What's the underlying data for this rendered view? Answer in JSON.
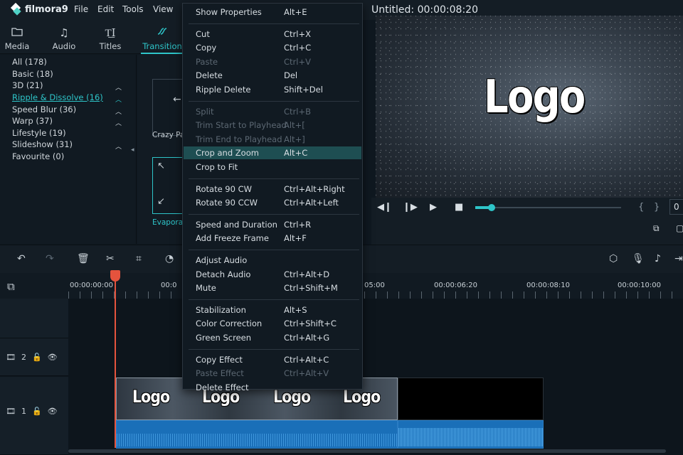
{
  "menubar": {
    "app_name": "filmora9",
    "items": [
      "File",
      "Edit",
      "Tools",
      "View"
    ],
    "project_title": "Untitled:",
    "project_time": "00:00:08:20"
  },
  "tabs": [
    {
      "label": "Media",
      "icon": "folder-icon"
    },
    {
      "label": "Audio",
      "icon": "music-icon"
    },
    {
      "label": "Titles",
      "icon": "titles-icon"
    },
    {
      "label": "Transition",
      "icon": "transition-icon",
      "active": true
    }
  ],
  "categories": [
    {
      "label": "All (178)"
    },
    {
      "label": "Basic (18)"
    },
    {
      "label": "3D (21)",
      "chevron": true
    },
    {
      "label": "Ripple & Dissolve (16)",
      "chevron": true,
      "selected": true
    },
    {
      "label": "Speed Blur (36)",
      "chevron": true
    },
    {
      "label": "Warp (37)",
      "chevron": true
    },
    {
      "label": "Lifestyle (19)"
    },
    {
      "label": "Slideshow (31)",
      "chevron": true
    },
    {
      "label": "Favourite (0)"
    }
  ],
  "thumbnails": [
    {
      "label": "Crazy Pa"
    },
    {
      "label": "Evapora",
      "selected": true
    }
  ],
  "preview": {
    "overlay_text": "Logo"
  },
  "player": {
    "progress": 0.1,
    "time_partial": "0"
  },
  "ruler": {
    "ticks": [
      "00:00:00:00",
      "00:0",
      "05:00",
      "00:00:06:20",
      "00:00:08:10",
      "00:00:10:00"
    ]
  },
  "tracks": [
    {
      "number": "2"
    },
    {
      "number": "1"
    }
  ],
  "clip": {
    "logo_text": "Logo"
  },
  "context_menu": {
    "items": [
      {
        "label": "Show Properties",
        "shortcut": "Alt+E"
      },
      {
        "sep": true
      },
      {
        "label": "Cut",
        "shortcut": "Ctrl+X"
      },
      {
        "label": "Copy",
        "shortcut": "Ctrl+C"
      },
      {
        "label": "Paste",
        "shortcut": "Ctrl+V",
        "disabled": true
      },
      {
        "label": "Delete",
        "shortcut": "Del"
      },
      {
        "label": "Ripple Delete",
        "shortcut": "Shift+Del"
      },
      {
        "sep": true
      },
      {
        "label": "Split",
        "shortcut": "Ctrl+B",
        "disabled": true
      },
      {
        "label": "Trim Start to Playhead",
        "shortcut": "Alt+[",
        "disabled": true
      },
      {
        "label": "Trim End to Playhead",
        "shortcut": "Alt+]",
        "disabled": true
      },
      {
        "label": "Crop and Zoom",
        "shortcut": "Alt+C",
        "highlighted": true
      },
      {
        "label": "Crop to Fit",
        "shortcut": ""
      },
      {
        "sep": true
      },
      {
        "label": "Rotate 90 CW",
        "shortcut": "Ctrl+Alt+Right"
      },
      {
        "label": "Rotate 90 CCW",
        "shortcut": "Ctrl+Alt+Left"
      },
      {
        "sep": true
      },
      {
        "label": "Speed and Duration",
        "shortcut": "Ctrl+R"
      },
      {
        "label": "Add Freeze Frame",
        "shortcut": "Alt+F"
      },
      {
        "sep": true
      },
      {
        "label": "Adjust Audio",
        "shortcut": ""
      },
      {
        "label": "Detach Audio",
        "shortcut": "Ctrl+Alt+D"
      },
      {
        "label": "Mute",
        "shortcut": "Ctrl+Shift+M"
      },
      {
        "sep": true
      },
      {
        "label": "Stabilization",
        "shortcut": "Alt+S"
      },
      {
        "label": "Color Correction",
        "shortcut": "Ctrl+Shift+C"
      },
      {
        "label": "Green Screen",
        "shortcut": "Ctrl+Alt+G"
      },
      {
        "sep": true
      },
      {
        "label": "Copy Effect",
        "shortcut": "Ctrl+Alt+C"
      },
      {
        "label": "Paste Effect",
        "shortcut": "Ctrl+Alt+V",
        "disabled": true
      },
      {
        "label": "Delete Effect",
        "shortcut": ""
      }
    ]
  },
  "colors": {
    "accent": "#2ec5c9",
    "playhead": "#e5533d",
    "audio_clip": "#1a6fb8",
    "menu_highlight": "#1e4e52"
  }
}
